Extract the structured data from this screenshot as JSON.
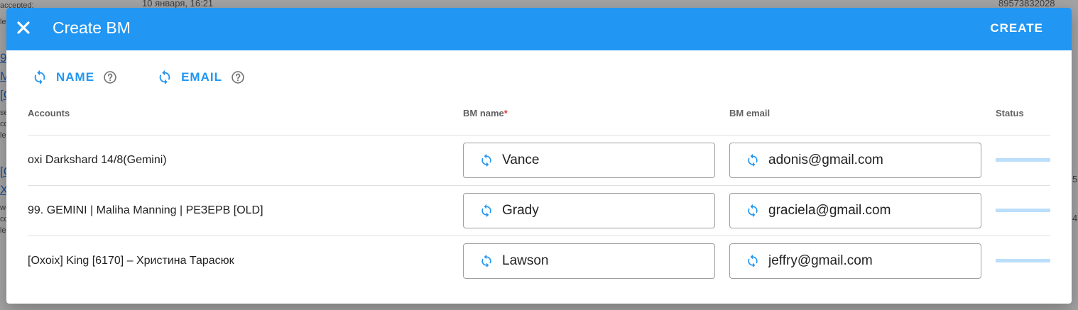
{
  "background": {
    "top_snippet": "10 января, 16:21",
    "right_number": "89573832028",
    "left_text_accepted": "accepted:",
    "left_links": [
      "9",
      "M",
      "[C",
      "[C",
      "X"
    ],
    "left_small": [
      "le",
      "se",
      "cc",
      "le",
      "wo",
      "cc",
      "le"
    ],
    "right_small": [
      "5",
      "4"
    ]
  },
  "modal": {
    "title": "Create BM",
    "create_label": "CREATE",
    "generators": [
      {
        "label": "NAME"
      },
      {
        "label": "EMAIL"
      }
    ],
    "columns": {
      "accounts": "Accounts",
      "bm_name": "BM name",
      "required_mark": "*",
      "bm_email": "BM email",
      "status": "Status"
    },
    "rows": [
      {
        "account": "oxi Darkshard 14/8(Gemini)",
        "bm_name": "Vance",
        "bm_email": "adonis@gmail.com",
        "progress": 0
      },
      {
        "account": "99. GEMINI | Maliha Manning | РЕЗЕРВ [OLD]",
        "bm_name": "Grady",
        "bm_email": "graciela@gmail.com",
        "progress": 0
      },
      {
        "account": "[Oxoix] King [6170] – Христина Тарасюк",
        "bm_name": "Lawson",
        "bm_email": "jeffry@gmail.com",
        "progress": 0
      }
    ]
  },
  "colors": {
    "primary": "#2196f3",
    "status_track": "#bbdefb",
    "required": "#e53935"
  },
  "icons": {
    "close": "close-icon",
    "sync": "sync-icon",
    "help": "help-circle-icon"
  }
}
